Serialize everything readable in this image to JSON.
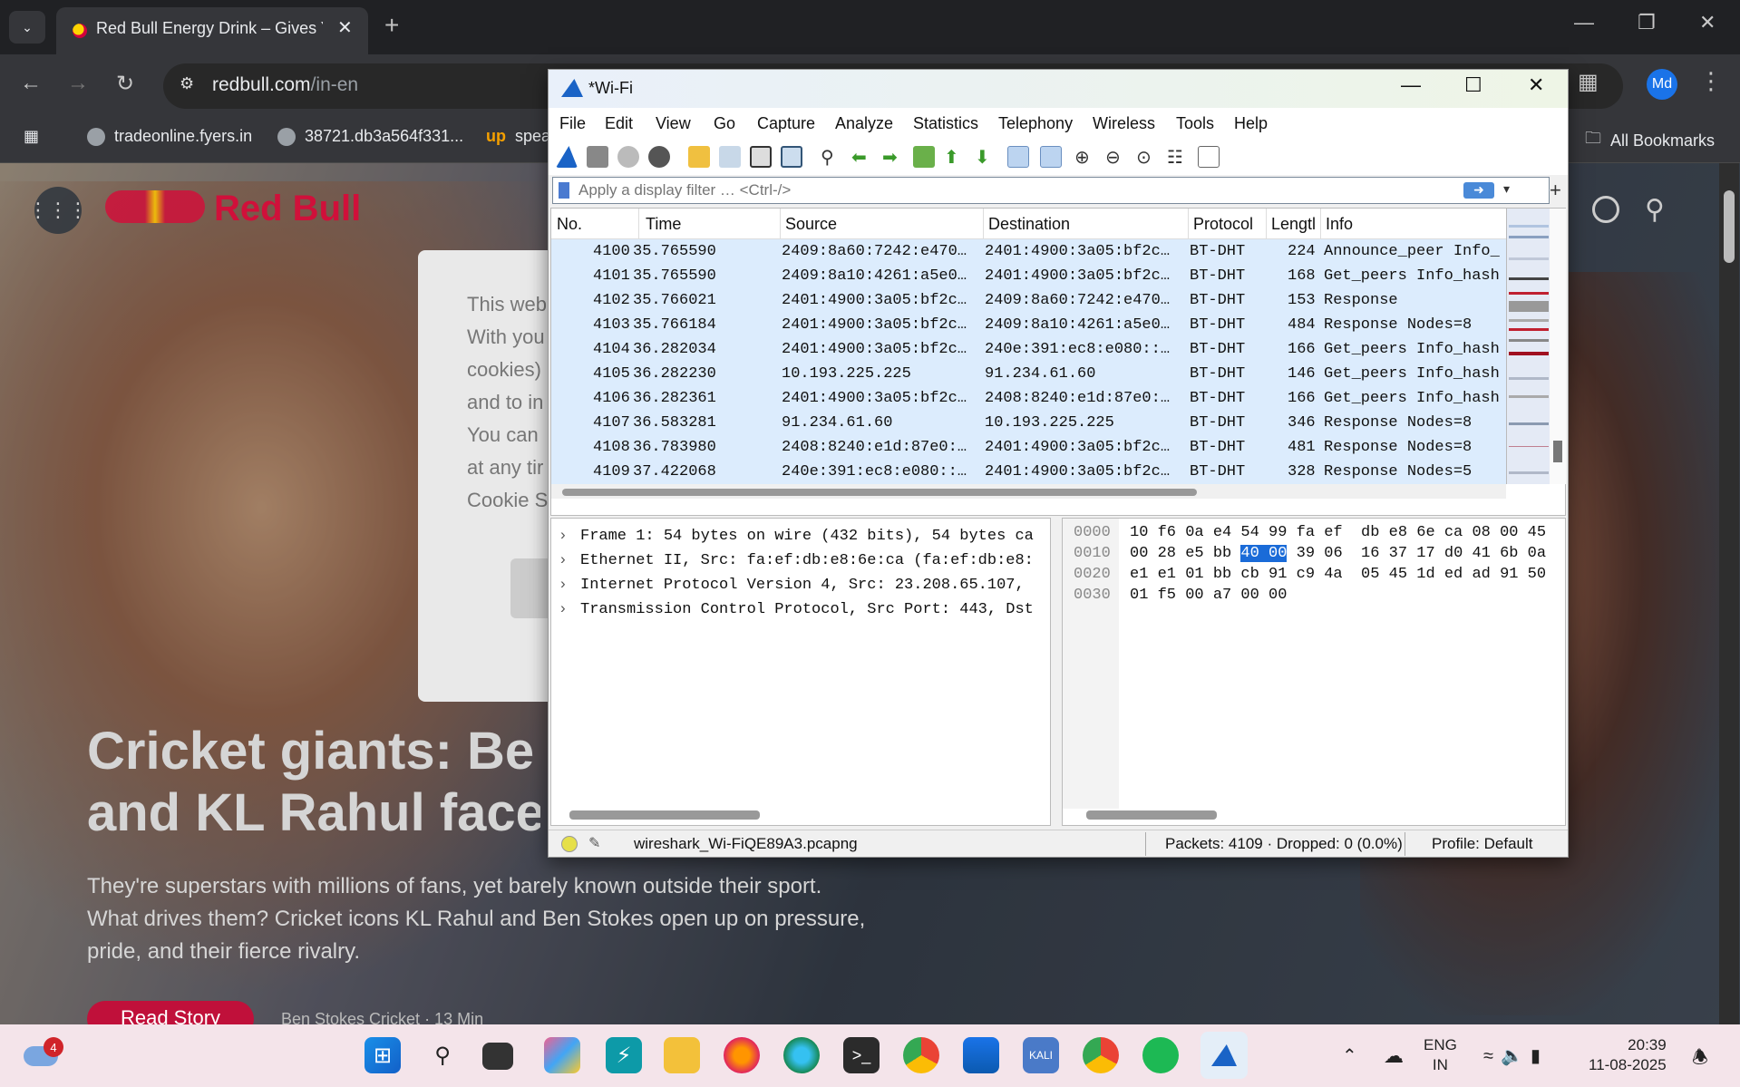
{
  "browser": {
    "tab_title": "Red Bull Energy Drink – Gives Y",
    "url_host": "redbull.com",
    "url_path": "/in-en",
    "avatar": "Md",
    "bookmarks": [
      "tradeonline.fyers.in",
      "38721.db3a564f331...",
      "spea"
    ],
    "all_bookmarks": "All Bookmarks"
  },
  "page": {
    "brand": "Red Bull",
    "modal_lines": [
      "This web",
      "With you",
      "cookies)",
      "and to in",
      "You can",
      "at any tir",
      "Cookie S"
    ],
    "headline": [
      "Cricket giants: Be",
      "and KL Rahul face"
    ],
    "subline": "They're superstars with millions of fans, yet barely known outside their sport. What drives them? Cricket icons KL Rahul and Ben Stokes open up on pressure, pride, and their fierce rivalry.",
    "cta": "Read Story",
    "meta": "Ben Stokes    Cricket · 13 Min"
  },
  "wireshark": {
    "title": "*Wi-Fi",
    "menus": [
      "File",
      "Edit",
      "View",
      "Go",
      "Capture",
      "Analyze",
      "Statistics",
      "Telephony",
      "Wireless",
      "Tools",
      "Help"
    ],
    "filter_placeholder": "Apply a display filter … <Ctrl-/>",
    "columns": [
      "No.",
      "Time",
      "Source",
      "Destination",
      "Protocol",
      "Lengtl",
      "Info"
    ],
    "rows": [
      {
        "no": "4100",
        "time": "35.765590",
        "src": "2409:8a60:7242:e470…",
        "dst": "2401:4900:3a05:bf2c…",
        "proto": "BT-DHT",
        "len": "224",
        "info": "Announce_peer Info_"
      },
      {
        "no": "4101",
        "time": "35.765590",
        "src": "2409:8a10:4261:a5e0…",
        "dst": "2401:4900:3a05:bf2c…",
        "proto": "BT-DHT",
        "len": "168",
        "info": "Get_peers Info_hash"
      },
      {
        "no": "4102",
        "time": "35.766021",
        "src": "2401:4900:3a05:bf2c…",
        "dst": "2409:8a60:7242:e470…",
        "proto": "BT-DHT",
        "len": "153",
        "info": "Response"
      },
      {
        "no": "4103",
        "time": "35.766184",
        "src": "2401:4900:3a05:bf2c…",
        "dst": "2409:8a10:4261:a5e0…",
        "proto": "BT-DHT",
        "len": "484",
        "info": "Response Nodes=8"
      },
      {
        "no": "4104",
        "time": "36.282034",
        "src": "2401:4900:3a05:bf2c…",
        "dst": "240e:391:ec8:e080::…",
        "proto": "BT-DHT",
        "len": "166",
        "info": "Get_peers Info_hash"
      },
      {
        "no": "4105",
        "time": "36.282230",
        "src": "10.193.225.225",
        "dst": "91.234.61.60",
        "proto": "BT-DHT",
        "len": "146",
        "info": "Get_peers Info_hash"
      },
      {
        "no": "4106",
        "time": "36.282361",
        "src": "2401:4900:3a05:bf2c…",
        "dst": "2408:8240:e1d:87e0:…",
        "proto": "BT-DHT",
        "len": "166",
        "info": "Get_peers Info_hash"
      },
      {
        "no": "4107",
        "time": "36.583281",
        "src": "91.234.61.60",
        "dst": "10.193.225.225",
        "proto": "BT-DHT",
        "len": "346",
        "info": "Response Nodes=8"
      },
      {
        "no": "4108",
        "time": "36.783980",
        "src": "2408:8240:e1d:87e0:…",
        "dst": "2401:4900:3a05:bf2c…",
        "proto": "BT-DHT",
        "len": "481",
        "info": "Response Nodes=8"
      },
      {
        "no": "4109",
        "time": "37.422068",
        "src": "240e:391:ec8:e080::…",
        "dst": "2401:4900:3a05:bf2c…",
        "proto": "BT-DHT",
        "len": "328",
        "info": "Response Nodes=5"
      }
    ],
    "details": [
      "Frame 1: 54 bytes on wire (432 bits), 54 bytes ca",
      "Ethernet II, Src: fa:ef:db:e8:6e:ca (fa:ef:db:e8:",
      "Internet Protocol Version 4, Src: 23.208.65.107,",
      "Transmission Control Protocol, Src Port: 443, Dst"
    ],
    "bytes": [
      {
        "off": "0000",
        "pre": "10 f6 0a e4 54 99 fa ef  db e8 6e ca 08 00 45",
        "hl": "",
        "post": ""
      },
      {
        "off": "0010",
        "pre": "00 28 e5 bb ",
        "hl": "40 00",
        "post": " 39 06  16 37 17 d0 41 6b 0a"
      },
      {
        "off": "0020",
        "pre": "e1 e1 01 bb cb 91 c9 4a  05 45 1d ed ad 91 50",
        "hl": "",
        "post": ""
      },
      {
        "off": "0030",
        "pre": "01 f5 00 a7 00 00",
        "hl": "",
        "post": ""
      }
    ],
    "status_file": "wireshark_Wi-FiQE89A3.pcapng",
    "status_packets": "Packets: 4109 · Dropped: 0 (0.0%)",
    "status_profile": "Profile: Default"
  },
  "taskbar": {
    "weather_badge": "4",
    "lang_line1": "ENG",
    "lang_line2": "IN",
    "time": "20:39",
    "date": "11-08-2025"
  },
  "colors": {
    "selected_bytes": "#1a6bd8",
    "packet_row_bg": "#dcecfd",
    "redbull_red": "#d0103a"
  }
}
